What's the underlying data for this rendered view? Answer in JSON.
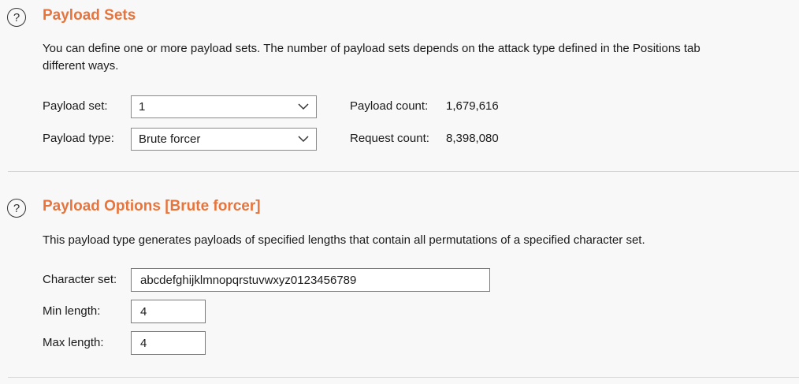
{
  "payload_sets": {
    "title": "Payload Sets",
    "help_glyph": "?",
    "description": "You can define one or more payload sets. The number of payload sets depends on the attack type defined in the Positions tab\ndifferent ways.",
    "payload_set_label": "Payload set:",
    "payload_set_value": "1",
    "payload_type_label": "Payload type:",
    "payload_type_value": "Brute forcer",
    "payload_count_label": "Payload count:",
    "payload_count_value": "1,679,616",
    "request_count_label": "Request count:",
    "request_count_value": "8,398,080"
  },
  "payload_options": {
    "title": "Payload Options [Brute forcer]",
    "help_glyph": "?",
    "description": "This payload type generates payloads of specified lengths that contain all permutations of a specified character set.",
    "character_set_label": "Character set:",
    "character_set_value": "abcdefghijklmnopqrstuvwxyz0123456789",
    "min_length_label": "Min length:",
    "min_length_value": "4",
    "max_length_label": "Max length:",
    "max_length_value": "4"
  },
  "colors": {
    "title_accent": "#e8743b",
    "background": "#f8f8f8"
  },
  "icons": [
    "help-icon",
    "chevron-down-icon"
  ]
}
